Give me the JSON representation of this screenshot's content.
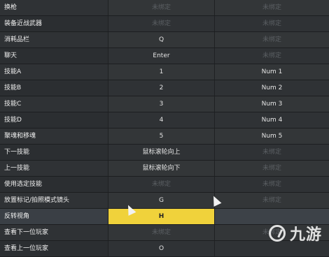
{
  "unbound_label": "未绑定",
  "rows": [
    {
      "action": "换枪",
      "primary": "未绑定",
      "secondary": "未绑定"
    },
    {
      "action": "装备近战武器",
      "primary": "未绑定",
      "secondary": "未绑定"
    },
    {
      "action": "消耗品栏",
      "primary": "Q",
      "secondary": "未绑定"
    },
    {
      "action": "聊天",
      "primary": "Enter",
      "secondary": "未绑定"
    },
    {
      "action": "技能A",
      "primary": "1",
      "secondary": "Num 1"
    },
    {
      "action": "技能B",
      "primary": "2",
      "secondary": "Num 2"
    },
    {
      "action": "技能C",
      "primary": "3",
      "secondary": "Num 3"
    },
    {
      "action": "技能D",
      "primary": "4",
      "secondary": "Num 4"
    },
    {
      "action": "聚魂和移魂",
      "primary": "5",
      "secondary": "Num 5"
    },
    {
      "action": "下一技能",
      "primary": "鼠标滚轮向上",
      "secondary": "未绑定"
    },
    {
      "action": "上一技能",
      "primary": "鼠标滚轮向下",
      "secondary": "未绑定"
    },
    {
      "action": "使用选定技能",
      "primary": "未绑定",
      "secondary": "未绑定"
    },
    {
      "action": "放置标记/拍照模式镜头",
      "primary": "G",
      "secondary": "未绑定"
    },
    {
      "action": "反转视角",
      "primary": "H",
      "secondary": ""
    },
    {
      "action": "查看下一位玩家",
      "primary": "未绑定",
      "secondary": "未绑定"
    },
    {
      "action": "查看上一位玩家",
      "primary": "O",
      "secondary": ""
    }
  ],
  "watermark": {
    "text": "九游"
  },
  "colors": {
    "selected_key": "#f0d23b",
    "background": "#2a2d30"
  }
}
